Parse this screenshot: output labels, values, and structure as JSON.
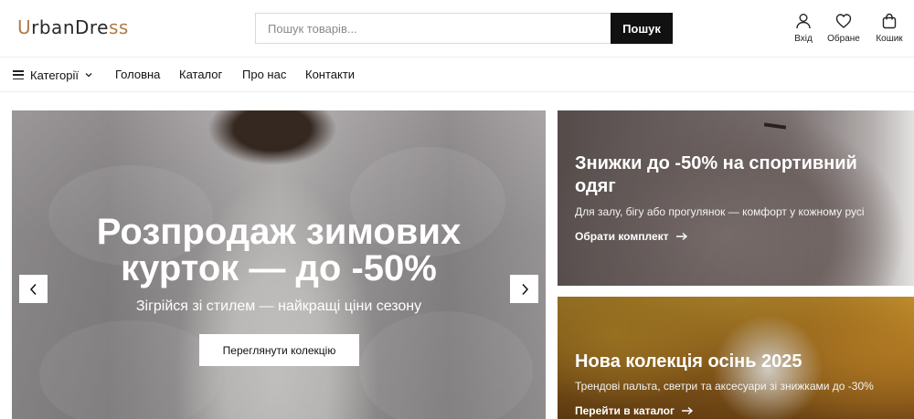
{
  "header": {
    "logo": {
      "part1": "U",
      "part2": "rbanDre",
      "part3": "ss"
    },
    "search": {
      "placeholder": "Пошук товарів...",
      "button_label": "Пошук"
    },
    "actions": [
      {
        "label": "Вхід",
        "icon": "user-icon"
      },
      {
        "label": "Обране",
        "icon": "heart-icon"
      },
      {
        "label": "Кошик",
        "icon": "bag-icon"
      }
    ]
  },
  "nav": {
    "categories_label": "Категорії",
    "links": [
      "Головна",
      "Каталог",
      "Про нас",
      "Контакти"
    ]
  },
  "hero": {
    "title_line1": "Розпродаж зимових",
    "title_line2": "курток — до -50%",
    "subtitle": "Зігрійся зі стилем — найкращі ціни сезону",
    "button_label": "Переглянути колекцію"
  },
  "promos": [
    {
      "title": "Знижки до -50% на спортивний одяг",
      "text": "Для залу, бігу або прогулянок — комфорт у кожному русі",
      "link": "Обрати комплект"
    },
    {
      "title": "Нова колекція осінь 2025",
      "text": "Трендові пальта, светри та аксесуари зі знижками до -30%",
      "link": "Перейти в каталог"
    }
  ],
  "colors": {
    "accent": "#b07a4a",
    "button_dark": "#111111",
    "text": "#1a1a1a"
  }
}
